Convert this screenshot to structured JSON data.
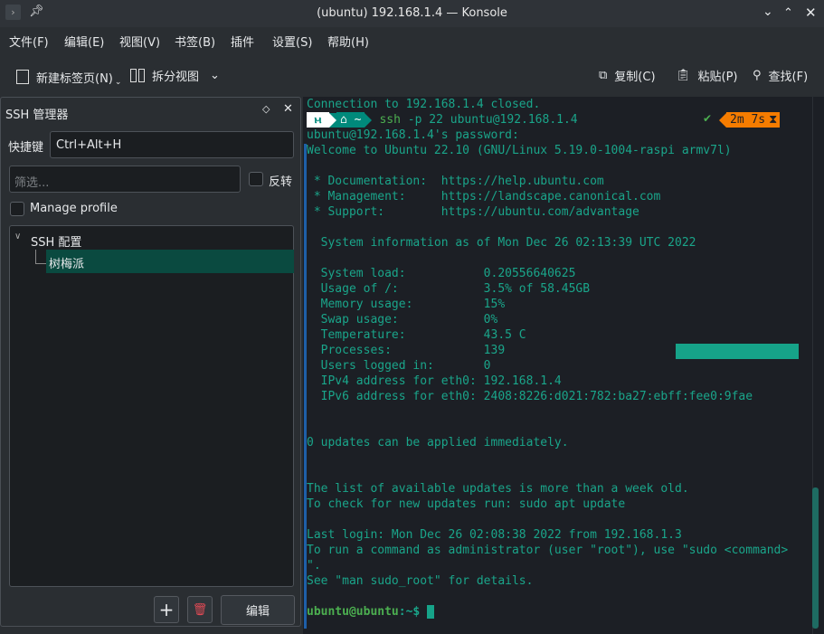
{
  "window": {
    "title": "(ubuntu) 192.168.1.4 — Konsole"
  },
  "menu": [
    "文件(F)",
    "编辑(E)",
    "视图(V)",
    "书签(B)",
    "插件",
    "设置(S)",
    "帮助(H)"
  ],
  "toolbar": {
    "new_tab": "新建标签页(N)",
    "split_view": "拆分视图",
    "copy": "复制(C)",
    "paste": "粘贴(P)",
    "find": "查找(F)"
  },
  "ssh_manager": {
    "title": "SSH 管理器",
    "shortcut_label": "快捷键",
    "shortcut_value": "Ctrl+Alt+H",
    "filter_placeholder": "筛选...",
    "invert_label": "反转",
    "manage_profile_label": "Manage profile",
    "tree_root": "SSH 配置",
    "tree_child": "树梅派",
    "edit_button": "编辑"
  },
  "terminal": {
    "prompt_segment": "~",
    "prompt_command": "ssh -p 22 ubuntu@192.168.1.4",
    "elapsed": "2m 7s",
    "lines": [
      "Connection to 192.168.1.4 closed.",
      "",
      "ubuntu@192.168.1.4's password:",
      "Welcome to Ubuntu 22.10 (GNU/Linux 5.19.0-1004-raspi armv7l)",
      "",
      " * Documentation:  https://help.ubuntu.com",
      " * Management:     https://landscape.canonical.com",
      " * Support:        https://ubuntu.com/advantage",
      "",
      "  System information as of Mon Dec 26 02:13:39 UTC 2022",
      "",
      "  System load:           0.20556640625",
      "  Usage of /:            3.5% of 58.45GB",
      "  Memory usage:          15%",
      "  Swap usage:            0%",
      "  Temperature:           43.5 C",
      "  Processes:             139",
      "  Users logged in:       0",
      "  IPv4 address for eth0: 192.168.1.4",
      "  IPv6 address for eth0: 2408:8226:d021:782:ba27:ebff:fee0:9fae",
      "",
      "",
      "0 updates can be applied immediately.",
      "",
      "",
      "The list of available updates is more than a week old.",
      "To check for new updates run: sudo apt update",
      "",
      "Last login: Mon Dec 26 02:08:38 2022 from 192.168.1.3",
      "To run a command as administrator (user \"root\"), use \"sudo <command>",
      "\".",
      "See \"man sudo_root\" for details.",
      ""
    ],
    "final_prompt_user": "ubuntu@ubuntu",
    "final_prompt_path": ":~$"
  },
  "colors": {
    "text": "#1aa58a",
    "prompt_green": "#4caf50",
    "orange": "#f57c00",
    "teal": "#00897b",
    "selection": "#0a4a40"
  }
}
